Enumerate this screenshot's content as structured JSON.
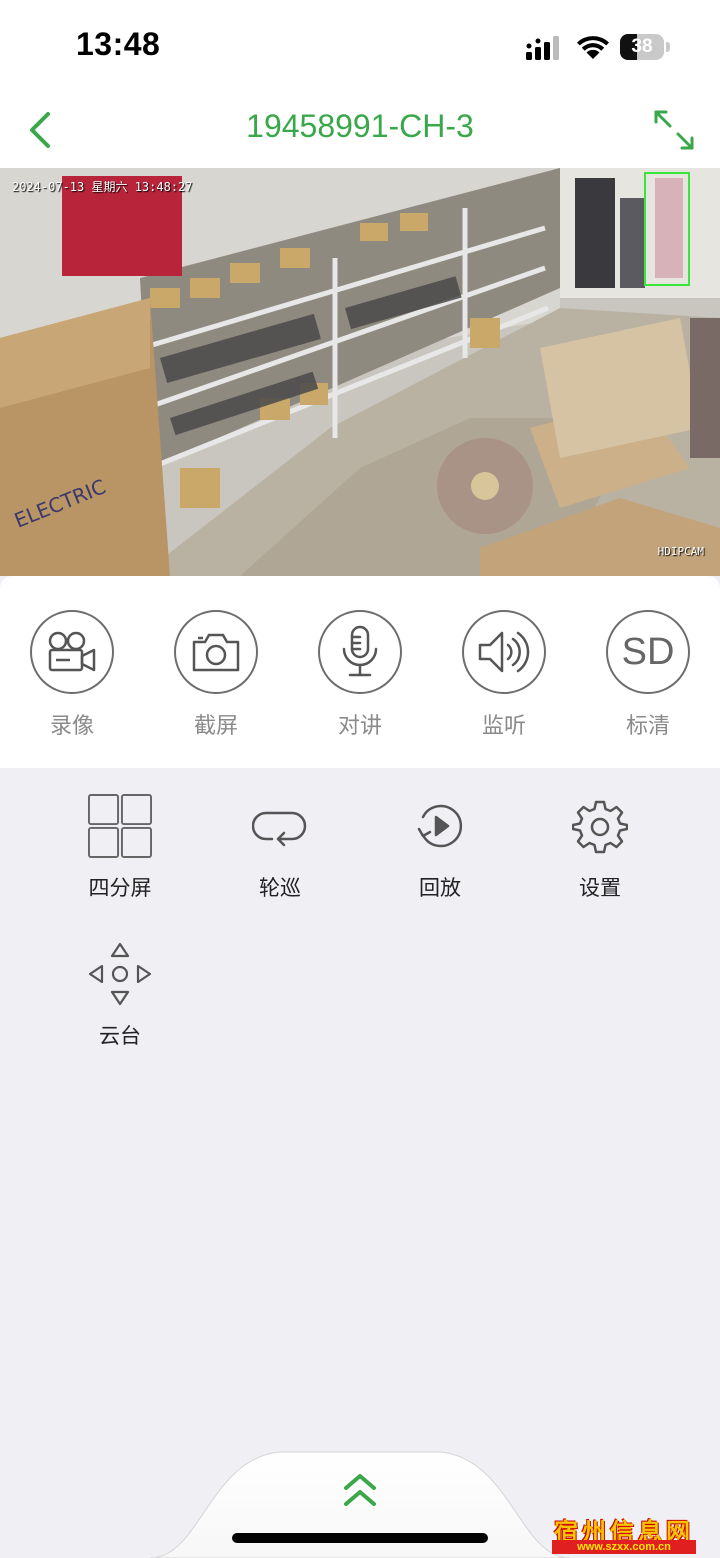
{
  "status": {
    "time": "13:48",
    "battery": "38",
    "battery_level": 0.38
  },
  "header": {
    "title": "19458991-CH-3"
  },
  "video": {
    "osd_timestamp": "2024-07-13 星期六 13:48:27",
    "brand_label": "HDIPCAM"
  },
  "controls": [
    {
      "label": "录像",
      "icon": "video-camera-icon"
    },
    {
      "label": "截屏",
      "icon": "camera-icon"
    },
    {
      "label": "对讲",
      "icon": "microphone-icon"
    },
    {
      "label": "监听",
      "icon": "speaker-icon"
    },
    {
      "label": "标清",
      "icon": "sd-icon",
      "icon_text": "SD"
    }
  ],
  "functions": [
    {
      "label": "四分屏",
      "icon": "four-split-icon"
    },
    {
      "label": "轮巡",
      "icon": "cycle-icon"
    },
    {
      "label": "回放",
      "icon": "playback-icon"
    },
    {
      "label": "设置",
      "icon": "gear-icon"
    },
    {
      "label": "云台",
      "icon": "ptz-icon"
    }
  ],
  "watermark": {
    "text": "宿州信息网",
    "url": "www.szxx.com.cn"
  },
  "colors": {
    "accent": "#3aa84a",
    "background": "#efeff4",
    "detect_box": "#39e639"
  }
}
